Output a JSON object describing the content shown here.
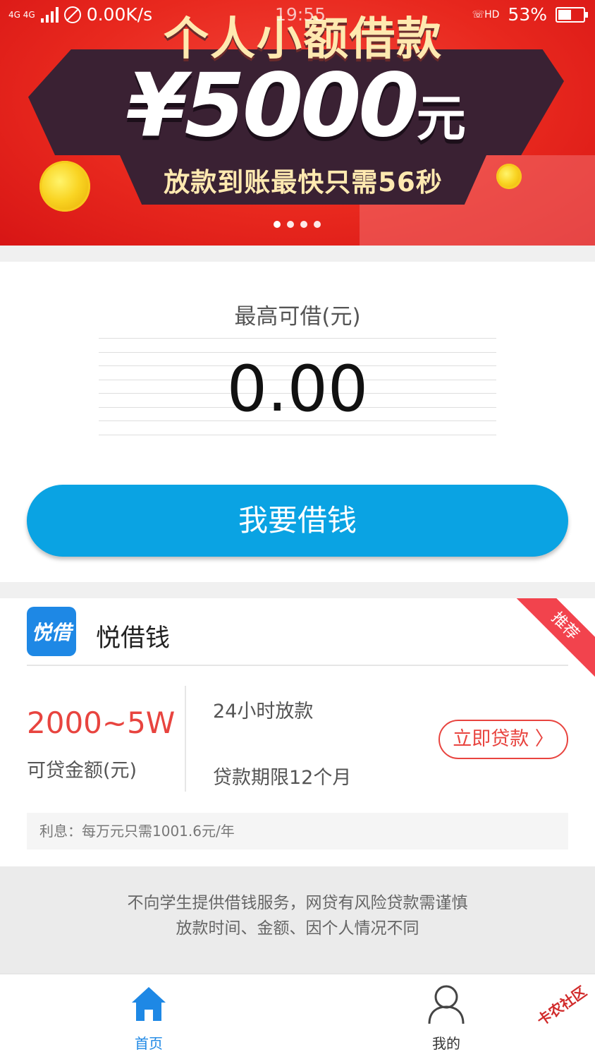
{
  "status_bar": {
    "network": "4G 4G",
    "speed": "0.00K/s",
    "time": "19:55",
    "hd": "HD",
    "battery": "53%"
  },
  "banner": {
    "title": "个人小额借款",
    "amount": "¥5000",
    "amount_unit": "元",
    "subtitle": "放款到账最快只需56秒",
    "slides": 4,
    "active_slide": 0
  },
  "borrow": {
    "max_label": "最高可借(元)",
    "amount": "0.00",
    "button_label": "我要借钱",
    "button_color": "#0aa3e3"
  },
  "product": {
    "logo_text": "悦借",
    "name": "悦借钱",
    "badge": "推荐",
    "range": "2000~5W",
    "range_label": "可贷金额(元)",
    "feature_1": "24小时放款",
    "feature_2": "贷款期限12个月",
    "apply_label": "立即贷款 〉",
    "interest": "利息：每万元只需1001.6元/年",
    "accent_color": "#e8443f"
  },
  "notice": {
    "line_1": "不向学生提供借钱服务，网贷有风险贷款需谨慎",
    "line_2": "放款时间、金额、因个人情况不同"
  },
  "tabs": [
    {
      "label": "首页",
      "icon": "home-icon",
      "active": true
    },
    {
      "label": "我的",
      "icon": "user-icon",
      "active": false
    }
  ],
  "watermark": "卡农社区"
}
